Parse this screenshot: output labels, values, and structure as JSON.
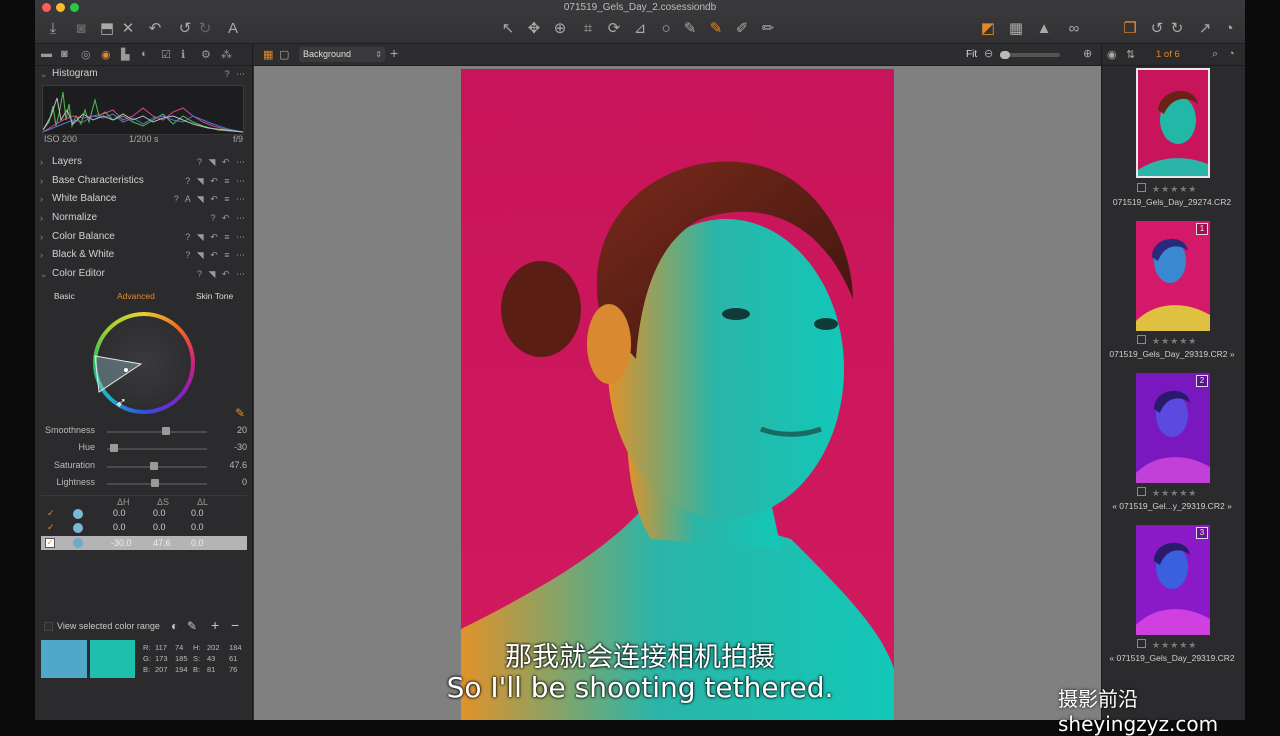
{
  "window": {
    "title": "071519_Gels_Day_2.cosessiondb"
  },
  "tools_panel": {
    "sections": [
      {
        "name": "Histogram",
        "controls": "? ⋯"
      },
      {
        "name": "Layers",
        "controls": "? ◥ ↶ ⋯"
      },
      {
        "name": "Base Characteristics",
        "controls": "? ◥ ↶ ≡ ⋯"
      },
      {
        "name": "White Balance",
        "controls": "? A ◥ ↶ ≡ ⋯"
      },
      {
        "name": "Normalize",
        "controls": "? ↶ ⋯"
      },
      {
        "name": "Color Balance",
        "controls": "? ◥ ↶ ≡ ⋯"
      },
      {
        "name": "Black & White",
        "controls": "? ◥ ↶ ≡ ⋯"
      },
      {
        "name": "Color Editor",
        "controls": "? ◥ ↶ ⋯"
      }
    ],
    "histogram": {
      "iso": "ISO 200",
      "shutter": "1/200 s",
      "aperture": "f/9"
    },
    "color_editor": {
      "tabs": [
        "Basic",
        "Advanced",
        "Skin Tone"
      ],
      "active_tab": "Advanced",
      "sliders": [
        {
          "label": "Smoothness",
          "value": "20",
          "pos": 0.6
        },
        {
          "label": "Hue",
          "value": "-30",
          "pos": 0.03
        },
        {
          "label": "Saturation",
          "value": "47.6",
          "pos": 0.47
        },
        {
          "label": "Lightness",
          "value": "0",
          "pos": 0.48
        }
      ],
      "table_headers": [
        "ΔH",
        "ΔS",
        "ΔL"
      ],
      "rows": [
        {
          "dh": "0.0",
          "ds": "0.0",
          "dl": "0.0"
        },
        {
          "dh": "0.0",
          "ds": "0.0",
          "dl": "0.0"
        },
        {
          "dh": "-30.0",
          "ds": "47.6",
          "dl": "0.0"
        }
      ],
      "view_selected": "View selected color range",
      "readout": {
        "r": "R:",
        "g": "G:",
        "b": "B:",
        "r1": "117",
        "g1": "173",
        "b1": "207",
        "r2": "74",
        "g2": "185",
        "b2": "194",
        "h": "H:",
        "s": "S:",
        "bl": "B:",
        "h1": "202",
        "s1": "43",
        "b1b": "81",
        "h2": "184",
        "s2": "61",
        "b2b": "76"
      },
      "swatch1": "#4fa8c8",
      "swatch2": "#1fbfae"
    }
  },
  "viewer": {
    "variant": "Background",
    "zoom": "Fit"
  },
  "browser": {
    "counter": "1 of 6",
    "thumbs": [
      {
        "name": "071519_Gels_Day_29274.CR2",
        "badge": "",
        "stars": "★★★★★"
      },
      {
        "name": "071519_Gels_Day_29319.CR2",
        "badge": "1",
        "stars": "★★★★★"
      },
      {
        "name": "071519_Gel...y_29319.CR2",
        "badge": "2",
        "stars": "★★★★★"
      },
      {
        "name": "071519_Gels_Day_29319.CR2",
        "badge": "3",
        "stars": "★★★★★"
      }
    ]
  },
  "subtitles": {
    "zh": "那我就会连接相机拍摄",
    "en": "So I'll be shooting tethered."
  },
  "watermark": "摄影前沿sheyingzyz.com",
  "colors": {
    "accent": "#e3892a",
    "backdrop": "#c8145a",
    "cyan": "#16c4b4"
  }
}
